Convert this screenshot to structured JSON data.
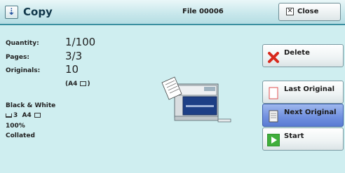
{
  "window": {
    "title": "Copy",
    "file_label": "File 00006",
    "close_label": "Close"
  },
  "info": {
    "quantity_label": "Quantity:",
    "quantity_value": "1/100",
    "pages_label": "Pages:",
    "pages_value": "3/3",
    "originals_label": "Originals:",
    "originals_value": "10",
    "originals_size": "(A4",
    "originals_size_end": ")",
    "color_mode": "Black & White",
    "tray": "3",
    "paper_size": "A4",
    "zoom": "100%",
    "output": "Collated"
  },
  "buttons": {
    "delete": "Delete",
    "last_original": "Last Original",
    "next_original": "Next Original",
    "start": "Start"
  },
  "colors": {
    "background": "#cfeef0",
    "accent": "#3a8fa0",
    "selected_button": "#6f8fdf"
  }
}
